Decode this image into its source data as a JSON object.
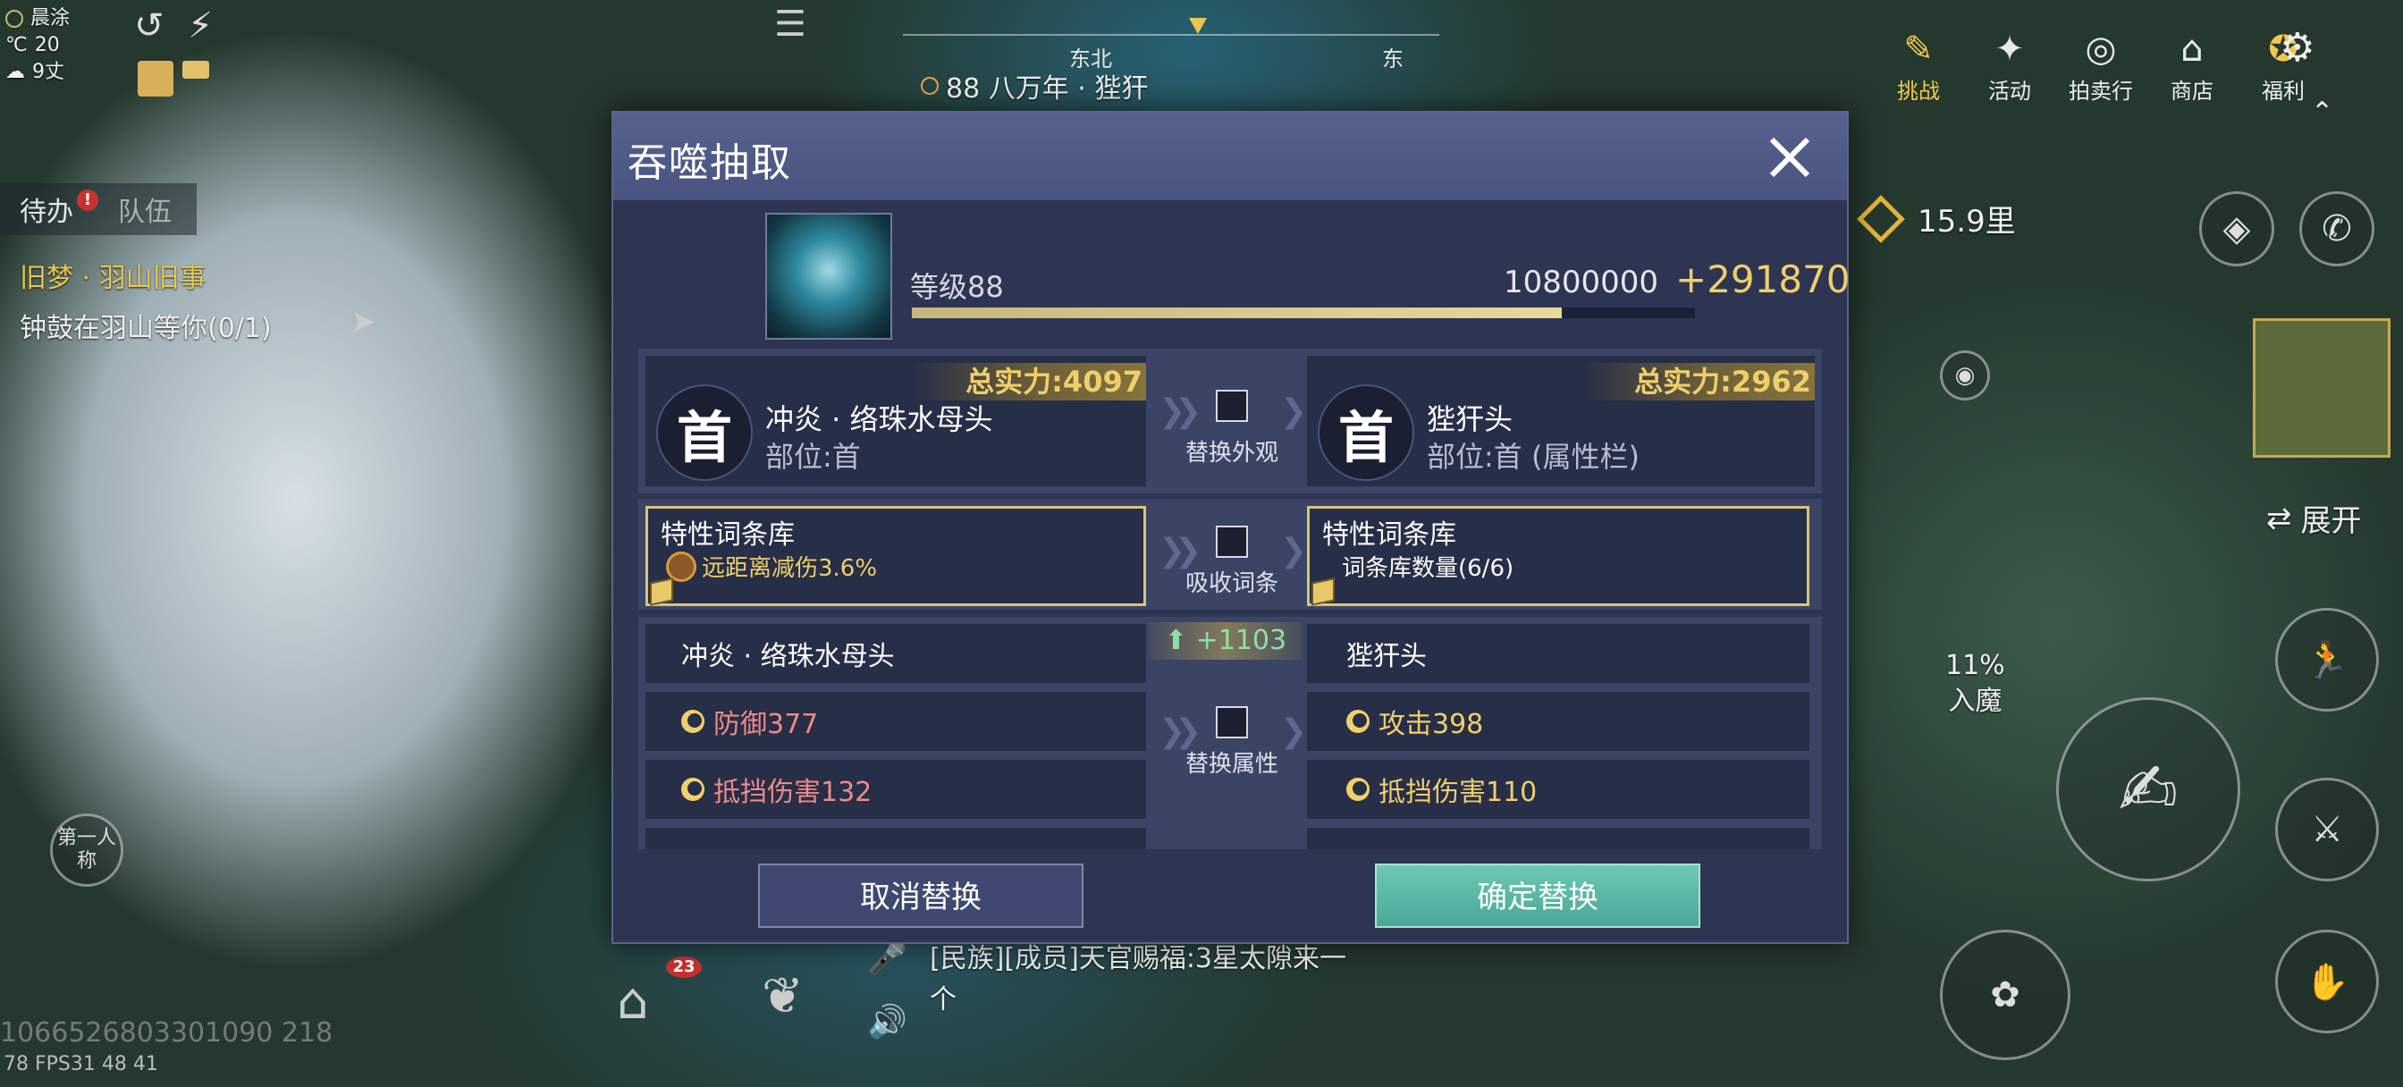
{
  "hud": {
    "weather": {
      "condition": "晨涂",
      "temperature": "20",
      "wind": "9丈"
    },
    "quest_tabs": {
      "todo": "待办",
      "team": "队伍",
      "todo_badge": "!"
    },
    "quest": {
      "title": "旧梦 · 羽山旧事",
      "desc": "钟鼓在羽山等你(0/1)"
    },
    "compass": {
      "dir_ne": "东北",
      "dir_e": "东"
    },
    "location": "88 八万年 · 狴犴",
    "menu": [
      {
        "label": "挑战",
        "icon": "challenge-icon"
      },
      {
        "label": "活动",
        "icon": "activity-icon"
      },
      {
        "label": "拍卖行",
        "icon": "auction-icon"
      },
      {
        "label": "商店",
        "icon": "shop-icon"
      },
      {
        "label": "福利",
        "icon": "welfare-icon"
      }
    ],
    "distance": "15.9里",
    "expand": "展开",
    "rage": {
      "percent": "11%",
      "label": "入魔"
    },
    "first_person": "第一人称",
    "chat": {
      "line1": "[民族][成员]天官赐福:3星太隙来一",
      "line2": "个",
      "badge": "23"
    },
    "uid": "1066526803301090 218",
    "fps": "78   FPS31   48   41"
  },
  "modal": {
    "title": "吞噬抽取",
    "level_label": "等级88",
    "exp_value": "10800000",
    "exp_gain": "+291870",
    "exp_fill": 0.83,
    "left_item": {
      "power": "总实力:4097",
      "emblem": "首",
      "name": "冲炎 · 络珠水母头",
      "slot": "部位:首"
    },
    "right_item": {
      "power": "总实力:2962",
      "emblem": "首",
      "name": "狴犴头",
      "slot": "部位:首 (属性栏)"
    },
    "replace_appearance": "替换外观",
    "absorb_traits": "吸收词条",
    "replace_attributes": "替换属性",
    "left_trait": {
      "title": "特性词条库",
      "entry": "远距离减伤3.6%"
    },
    "right_trait": {
      "title": "特性词条库",
      "entry": "词条库数量(6/6)"
    },
    "power_gain": "+1103",
    "left_attrs": {
      "name": "冲炎 · 络珠水母头",
      "a1": "防御377",
      "a2": "抵挡伤害132"
    },
    "right_attrs": {
      "name": "狴犴头",
      "a1": "攻击398",
      "a2": "抵挡伤害110"
    },
    "cancel": "取消替换",
    "confirm": "确定替换",
    "colors": {
      "left_attr": "#ef8a86",
      "right_attr": "#f0cf6a",
      "gain": "#8fe0a0"
    }
  }
}
